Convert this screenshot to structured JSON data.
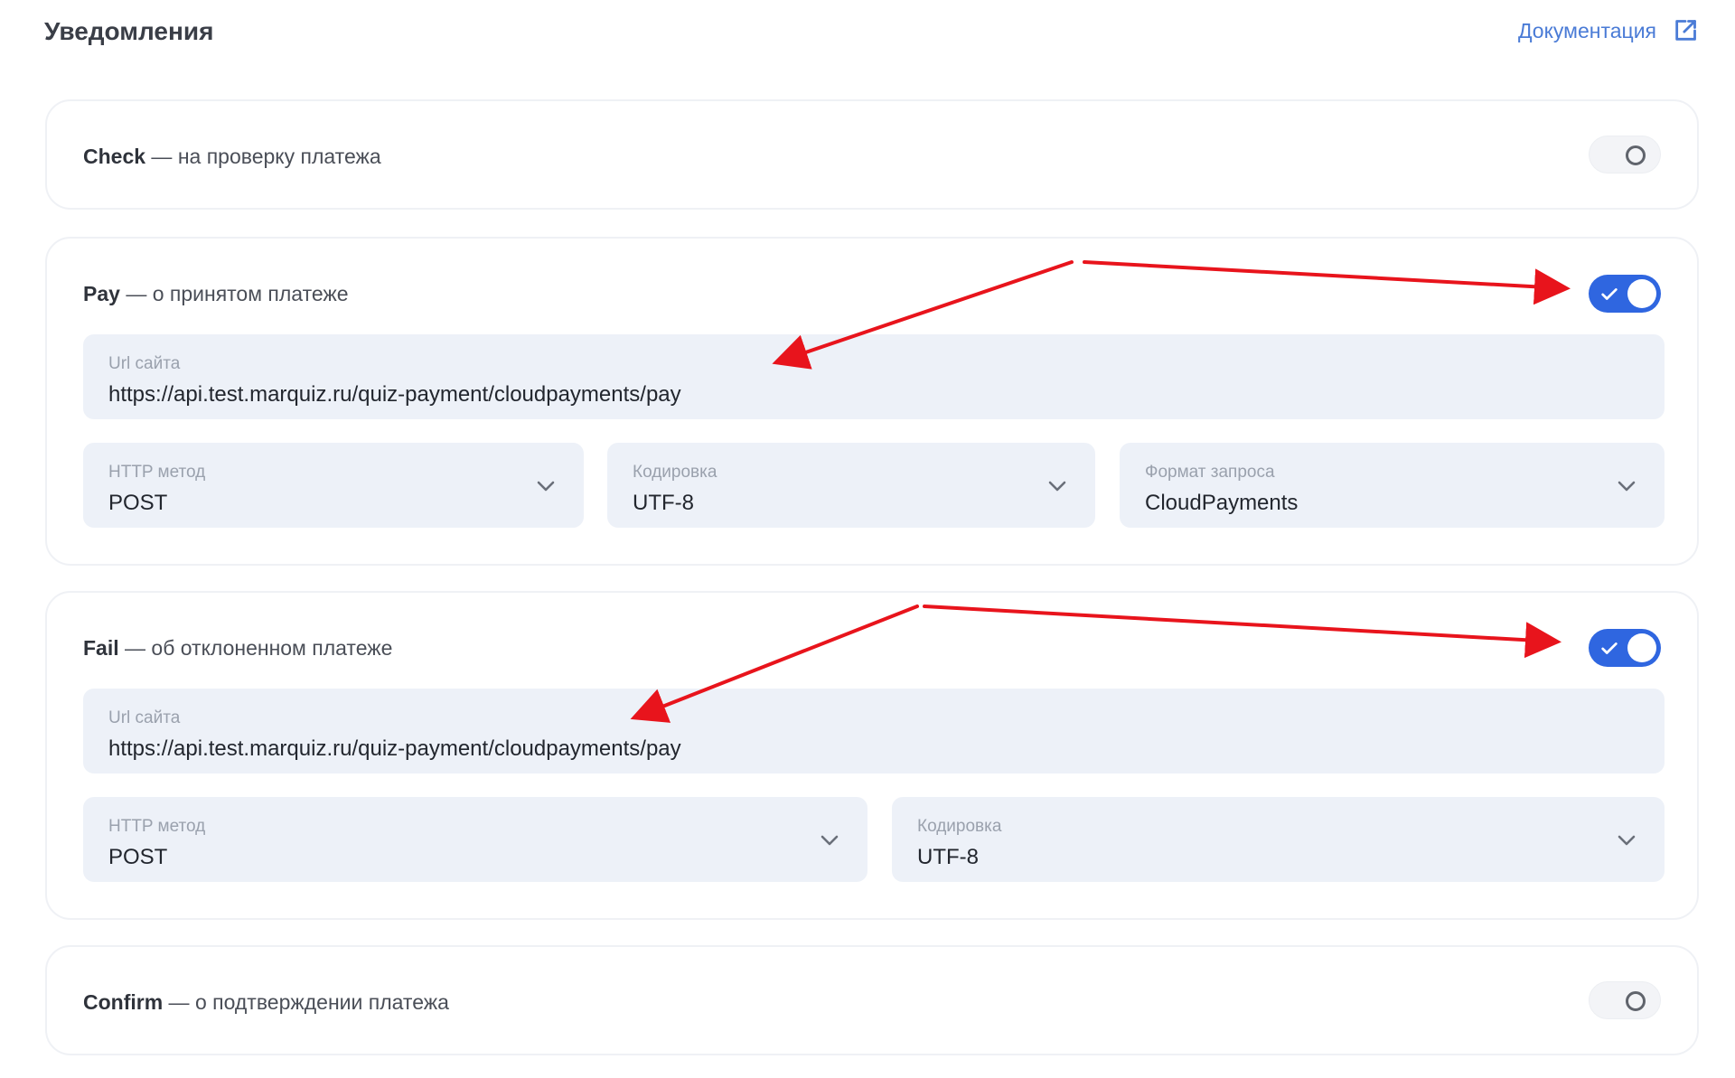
{
  "header": {
    "title": "Уведомления",
    "doc_link": "Документация"
  },
  "cards": {
    "check": {
      "name": "Check",
      "desc": " — на проверку платежа",
      "enabled": false
    },
    "pay": {
      "name": "Pay",
      "desc": " — о принятом платеже",
      "enabled": true,
      "url_label": "Url сайта",
      "url_value": "https://api.test.marquiz.ru/quiz-payment/cloudpayments/pay",
      "method_label": "HTTP метод",
      "method_value": "POST",
      "encoding_label": "Кодировка",
      "encoding_value": "UTF-8",
      "format_label": "Формат запроса",
      "format_value": "CloudPayments"
    },
    "fail": {
      "name": "Fail",
      "desc": " — об отклоненном платеже",
      "enabled": true,
      "url_label": "Url сайта",
      "url_value": "https://api.test.marquiz.ru/quiz-payment/cloudpayments/pay",
      "method_label": "HTTP метод",
      "method_value": "POST",
      "encoding_label": "Кодировка",
      "encoding_value": "UTF-8"
    },
    "confirm": {
      "name": "Confirm",
      "desc": " — о подтверждении платежа",
      "enabled": false
    }
  },
  "colors": {
    "accent": "#2f66e0",
    "link": "#4a7bd6",
    "field_bg": "#edf1f8",
    "annotation_arrow": "#e8141c"
  },
  "icons": {
    "doc_link": "external-link-icon",
    "select": "chevron-down-icon",
    "toggle_on": "checkmark-icon"
  }
}
